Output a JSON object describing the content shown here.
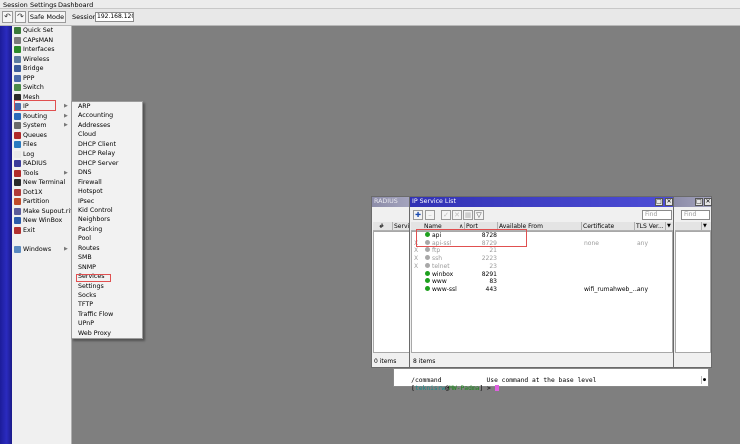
{
  "menubar": {
    "session": "Session",
    "settings": "Settings",
    "dashboard": "Dashboard"
  },
  "toolbar": {
    "undo_icon": "undo-icon",
    "redo_icon": "redo-icon",
    "safe_mode": "Safe Mode",
    "session_label": "Session:",
    "session_value": "192.168.120.1"
  },
  "sidebar": {
    "items": [
      {
        "label": "Quick Set",
        "icon": "wand-icon",
        "color": "#3a7a3a"
      },
      {
        "label": "CAPsMAN",
        "icon": "capsman-icon",
        "color": "#7a7a7a"
      },
      {
        "label": "Interfaces",
        "icon": "interfaces-icon",
        "color": "#2a8a2a"
      },
      {
        "label": "Wireless",
        "icon": "wireless-icon",
        "color": "#5a7aa0"
      },
      {
        "label": "Bridge",
        "icon": "bridge-icon",
        "color": "#3a5a9a"
      },
      {
        "label": "PPP",
        "icon": "ppp-icon",
        "color": "#4a6aaa"
      },
      {
        "label": "Switch",
        "icon": "switch-icon",
        "color": "#4a8a4a"
      },
      {
        "label": "Mesh",
        "icon": "mesh-icon",
        "color": "#2a2a2a"
      },
      {
        "label": "IP",
        "icon": "ip-icon",
        "color": "#4a6aaa",
        "submenu": true
      },
      {
        "label": "Routing",
        "icon": "routing-icon",
        "color": "#2a6aba",
        "submenu": true
      },
      {
        "label": "System",
        "icon": "system-icon",
        "color": "#6a6a6a",
        "submenu": true
      },
      {
        "label": "Queues",
        "icon": "queues-icon",
        "color": "#b02a2a"
      },
      {
        "label": "Files",
        "icon": "files-icon",
        "color": "#2a7ac0"
      },
      {
        "label": "Log",
        "icon": "log-icon",
        "color": "#e8e8e8"
      },
      {
        "label": "RADIUS",
        "icon": "radius-icon",
        "color": "#3a3a9a"
      },
      {
        "label": "Tools",
        "icon": "tools-icon",
        "color": "#b02a2a",
        "submenu": true
      },
      {
        "label": "New Terminal",
        "icon": "terminal-icon",
        "color": "#2a2a2a"
      },
      {
        "label": "Dot1X",
        "icon": "dot1x-icon",
        "color": "#b03a3a"
      },
      {
        "label": "Partition",
        "icon": "partition-icon",
        "color": "#c04a2a"
      },
      {
        "label": "Make Supout.rif",
        "icon": "supout-icon",
        "color": "#5a5a9a"
      },
      {
        "label": "New WinBox",
        "icon": "winbox-icon",
        "color": "#2a5aaa"
      },
      {
        "label": "Exit",
        "icon": "exit-icon",
        "color": "#b03030"
      },
      {
        "label": "Windows",
        "icon": "windows-icon",
        "color": "#5a8ac0",
        "submenu": true
      }
    ]
  },
  "submenu": {
    "items": [
      "ARP",
      "Accounting",
      "Addresses",
      "Cloud",
      "DHCP Client",
      "DHCP Relay",
      "DHCP Server",
      "DNS",
      "Firewall",
      "Hotspot",
      "IPsec",
      "Kid Control",
      "Neighbors",
      "Packing",
      "Pool",
      "Routes",
      "SMB",
      "SNMP",
      "Services",
      "Settings",
      "Socks",
      "TFTP",
      "Traffic Flow",
      "UPnP",
      "Web Proxy"
    ]
  },
  "radius_window": {
    "title": "RADIUS",
    "col_num": "#",
    "col_service": "Service",
    "status": "0 items"
  },
  "service_window": {
    "title": "IP Service List",
    "find_placeholder": "Find",
    "columns": [
      "Name",
      "Port",
      "Available From",
      "Certificate",
      "TLS Ver..."
    ],
    "rows": [
      {
        "flag": "",
        "name": "api",
        "port": "8728",
        "from": "",
        "cert": "",
        "tls": "",
        "enabled": true
      },
      {
        "flag": "X",
        "name": "api-ssl",
        "port": "8729",
        "from": "",
        "cert": "none",
        "tls": "any",
        "enabled": false
      },
      {
        "flag": "X",
        "name": "ftp",
        "port": "21",
        "from": "",
        "cert": "",
        "tls": "",
        "enabled": false
      },
      {
        "flag": "X",
        "name": "ssh",
        "port": "2223",
        "from": "",
        "cert": "",
        "tls": "",
        "enabled": false
      },
      {
        "flag": "X",
        "name": "telnet",
        "port": "23",
        "from": "",
        "cert": "",
        "tls": "",
        "enabled": false
      },
      {
        "flag": "",
        "name": "winbox",
        "port": "8291",
        "from": "",
        "cert": "",
        "tls": "",
        "enabled": true
      },
      {
        "flag": "",
        "name": "www",
        "port": "83",
        "from": "",
        "cert": "",
        "tls": "",
        "enabled": true
      },
      {
        "flag": "",
        "name": "www-ssl",
        "port": "443",
        "from": "",
        "cert": "wifi_rumahweb_...",
        "tls": "any",
        "enabled": true
      }
    ],
    "status": "8 items"
  },
  "third_window": {
    "find_placeholder": "Find"
  },
  "terminal": {
    "line1_cmd": "/command",
    "line1_desc": "Use command at the base level",
    "prompt_user": "teknisrw",
    "prompt_at": "@",
    "prompt_host": "MW-Padma",
    "prompt_end": "] > ",
    "prompt_open": "["
  },
  "colors": {
    "title_active": "#3c3cc4",
    "highlight": "#e05050",
    "enabled_dot": "#1ea01e"
  }
}
